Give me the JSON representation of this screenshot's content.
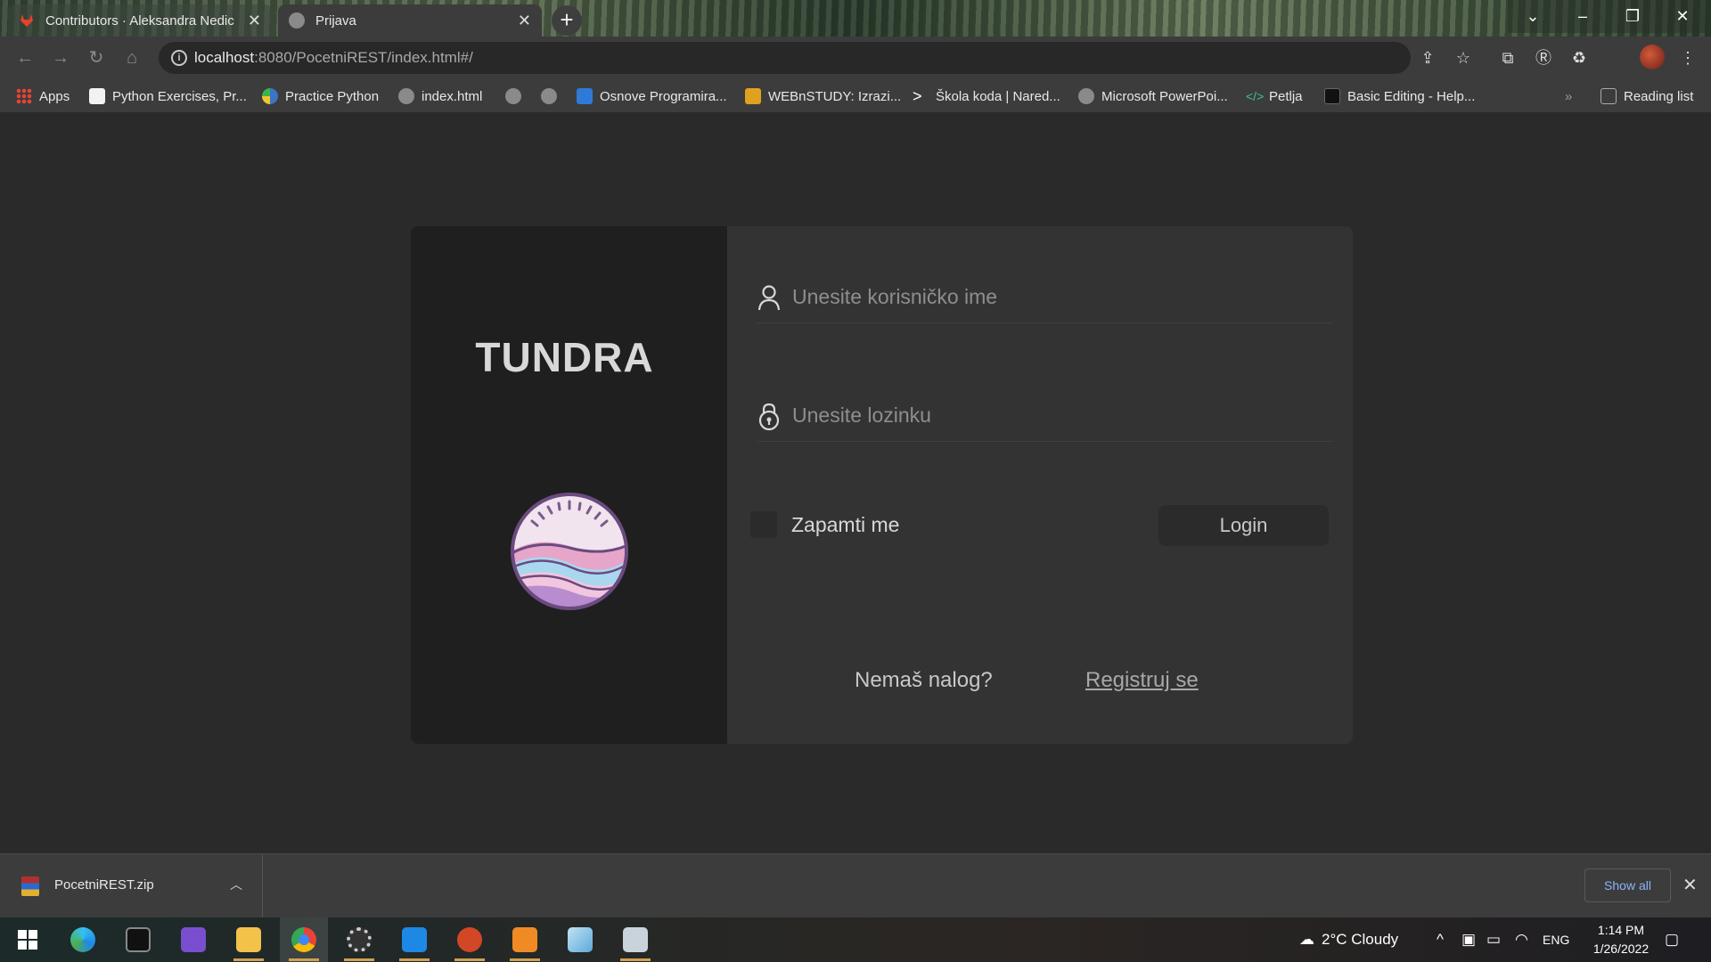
{
  "browser": {
    "tabs": [
      {
        "title": "Contributors · Aleksandra Nedic",
        "active": false
      },
      {
        "title": "Prijava",
        "active": true
      }
    ],
    "url": {
      "host": "localhost",
      "path": ":8080/PocetniREST/index.html#/"
    },
    "bookmarks": [
      {
        "label": "Apps",
        "icon": "apps-grid-icon"
      },
      {
        "label": "Python Exercises, Pr...",
        "icon": "w3-icon"
      },
      {
        "label": "Practice Python",
        "icon": "python-icon"
      },
      {
        "label": "index.html",
        "icon": "globe-icon"
      },
      {
        "label": "",
        "icon": "globe-icon"
      },
      {
        "label": "",
        "icon": "globe-icon"
      },
      {
        "label": "Osnove Programira...",
        "icon": "calendar-icon"
      },
      {
        "label": "WEBnSTUDY: Izrazi...",
        "icon": "graduation-cap-icon"
      },
      {
        "label": "Škola koda | Nared...",
        "icon": "chevron-icon"
      },
      {
        "label": "Microsoft PowerPoi...",
        "icon": "globe-icon"
      },
      {
        "label": "Petlja",
        "icon": "code-icon"
      },
      {
        "label": "Basic Editing - Help...",
        "icon": "jetbrains-icon"
      }
    ],
    "reading_list": "Reading list",
    "overflow": "»"
  },
  "login": {
    "brand": "TUNDRA",
    "username_placeholder": "Unesite korisničko ime",
    "password_placeholder": "Unesite lozinku",
    "remember_label": "Zapamti me",
    "login_label": "Login",
    "no_account": "Nemaš nalog?",
    "register_link": "Registruj se"
  },
  "downloads": {
    "file_name": "PocetniREST.zip",
    "show_all": "Show all"
  },
  "taskbar": {
    "weather": "2°C  Cloudy",
    "language": "ENG",
    "time": "1:14 PM",
    "date": "1/26/2022"
  },
  "colors": {
    "page_bg": "#2a2a2a",
    "card_left": "#1f1f1f",
    "card_right": "#333333",
    "link": "#8ab4f8"
  }
}
